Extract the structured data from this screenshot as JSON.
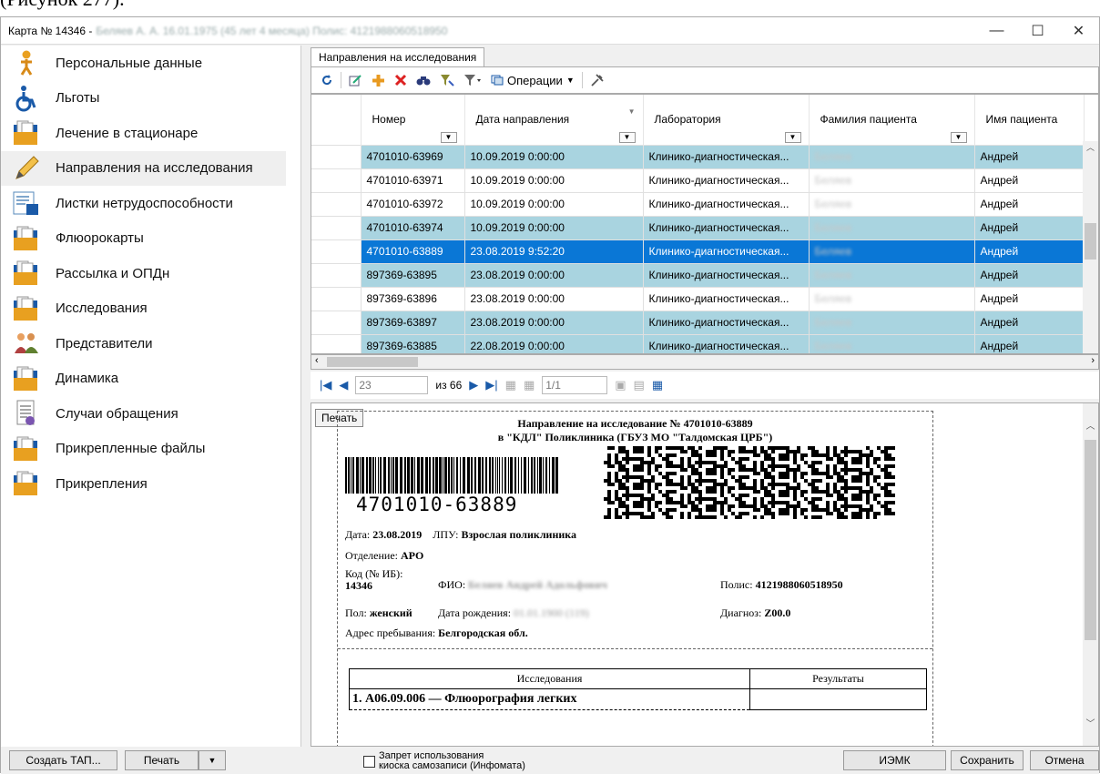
{
  "doc_caption": "(Рисунок 277).",
  "window": {
    "title_prefix": "Карта № 14346 -",
    "title_blurred": "Беляев А. А. 16.01.1975 (45 лет 4 месяца) Полис: 4121988060518950",
    "minimize": "—",
    "maximize": "☐",
    "close": "✕"
  },
  "sidebar": {
    "items": [
      {
        "label": "Персональные данные",
        "icon": "person-icon"
      },
      {
        "label": "Льготы",
        "icon": "wheelchair-icon"
      },
      {
        "label": "Лечение в стационаре",
        "icon": "folder-icon"
      },
      {
        "label": "Направления на исследования",
        "icon": "pencil-icon"
      },
      {
        "label": "Листки нетрудоспособности",
        "icon": "sick-list-icon"
      },
      {
        "label": "Флюорокарты",
        "icon": "folder-icon"
      },
      {
        "label": "Рассылка и ОПДн",
        "icon": "folder-icon"
      },
      {
        "label": "Исследования",
        "icon": "folder-icon"
      },
      {
        "label": "Представители",
        "icon": "people-icon"
      },
      {
        "label": "Динамика",
        "icon": "folder-icon"
      },
      {
        "label": "Случаи обращения",
        "icon": "document-icon"
      },
      {
        "label": "Прикрепленные файлы",
        "icon": "folder-icon"
      },
      {
        "label": "Прикрепления",
        "icon": "folder-icon"
      }
    ]
  },
  "tab": {
    "label": "Направления на исследования"
  },
  "toolbar": {
    "operations_label": "Операции"
  },
  "grid": {
    "columns": [
      "Номер",
      "Дата направления",
      "Лаборатория",
      "Фамилия пациента",
      "Имя пациента"
    ],
    "rows": [
      {
        "num": "4701010-63969",
        "date": "10.09.2019 0:00:00",
        "lab": "Клинико-диагностическая...",
        "surname": "Беляев",
        "name": "Андрей"
      },
      {
        "num": "4701010-63971",
        "date": "10.09.2019 0:00:00",
        "lab": "Клинико-диагностическая...",
        "surname": "Беляев",
        "name": "Андрей"
      },
      {
        "num": "4701010-63972",
        "date": "10.09.2019 0:00:00",
        "lab": "Клинико-диагностическая...",
        "surname": "Беляев",
        "name": "Андрей"
      },
      {
        "num": "4701010-63974",
        "date": "10.09.2019 0:00:00",
        "lab": "Клинико-диагностическая...",
        "surname": "Беляев",
        "name": "Андрей"
      },
      {
        "num": "4701010-63889",
        "date": "23.08.2019 9:52:20",
        "lab": "Клинико-диагностическая...",
        "surname": "Беляев",
        "name": "Андрей"
      },
      {
        "num": "897369-63895",
        "date": "23.08.2019 0:00:00",
        "lab": "Клинико-диагностическая...",
        "surname": "Беляев",
        "name": "Андрей"
      },
      {
        "num": "897369-63896",
        "date": "23.08.2019 0:00:00",
        "lab": "Клинико-диагностическая...",
        "surname": "Беляев",
        "name": "Андрей"
      },
      {
        "num": "897369-63897",
        "date": "23.08.2019 0:00:00",
        "lab": "Клинико-диагностическая...",
        "surname": "Беляев",
        "name": "Андрей"
      },
      {
        "num": "897369-63885",
        "date": "22.08.2019 0:00:00",
        "lab": "Клинико-диагностическая...",
        "surname": "Беляев",
        "name": "Андрей"
      }
    ],
    "selected_row_marker": "►"
  },
  "pager": {
    "current": "23",
    "of_label": "из 66",
    "page": "1/1"
  },
  "report": {
    "print_label": "Печать",
    "title_line1": "Направление на исследование № 4701010-63889",
    "title_line2": "в \"КДЛ\" Поликлиника (ГБУЗ МО \"Талдомская ЦРБ\")",
    "barcode_text": "4701010-63889",
    "date_label": "Дата:",
    "date_value": "23.08.2019",
    "lpu_label": "ЛПУ:",
    "lpu_value": "Взрослая поликлиника",
    "dept_label": "Отделение:",
    "dept_value": "АРО",
    "code_label": "Код (№ ИБ):",
    "code_value": "14346",
    "fio_label": "ФИО:",
    "fio_value": "Беляев Андрей Адольфович",
    "polis_label": "Полис:",
    "polis_value": "4121988060518950",
    "sex_label": "Пол:",
    "sex_value": "женский",
    "dob_label": "Дата рождения:",
    "dob_value": "01.01.1900 (119)",
    "diag_label": "Диагноз:",
    "diag_value": "Z00.0",
    "addr_label": "Адрес пребывания:",
    "addr_value": "Белгородская обл.",
    "table_col1": "Исследования",
    "table_col2": "Результаты",
    "study_1": "1. А06.09.006 — Флюорография легких"
  },
  "bottom": {
    "create_tap": "Создать ТАП...",
    "print": "Печать",
    "kiosk_line1": "Запрет использования",
    "kiosk_line2": "киоска самозаписи (Инфомата)",
    "iemk": "ИЭМК",
    "save": "Сохранить",
    "cancel": "Отмена"
  },
  "colors": {
    "row_alt": "#a9d4e0",
    "row_selected": "#0a77d6",
    "toolbar_icon_blue": "#1a5aa8"
  }
}
